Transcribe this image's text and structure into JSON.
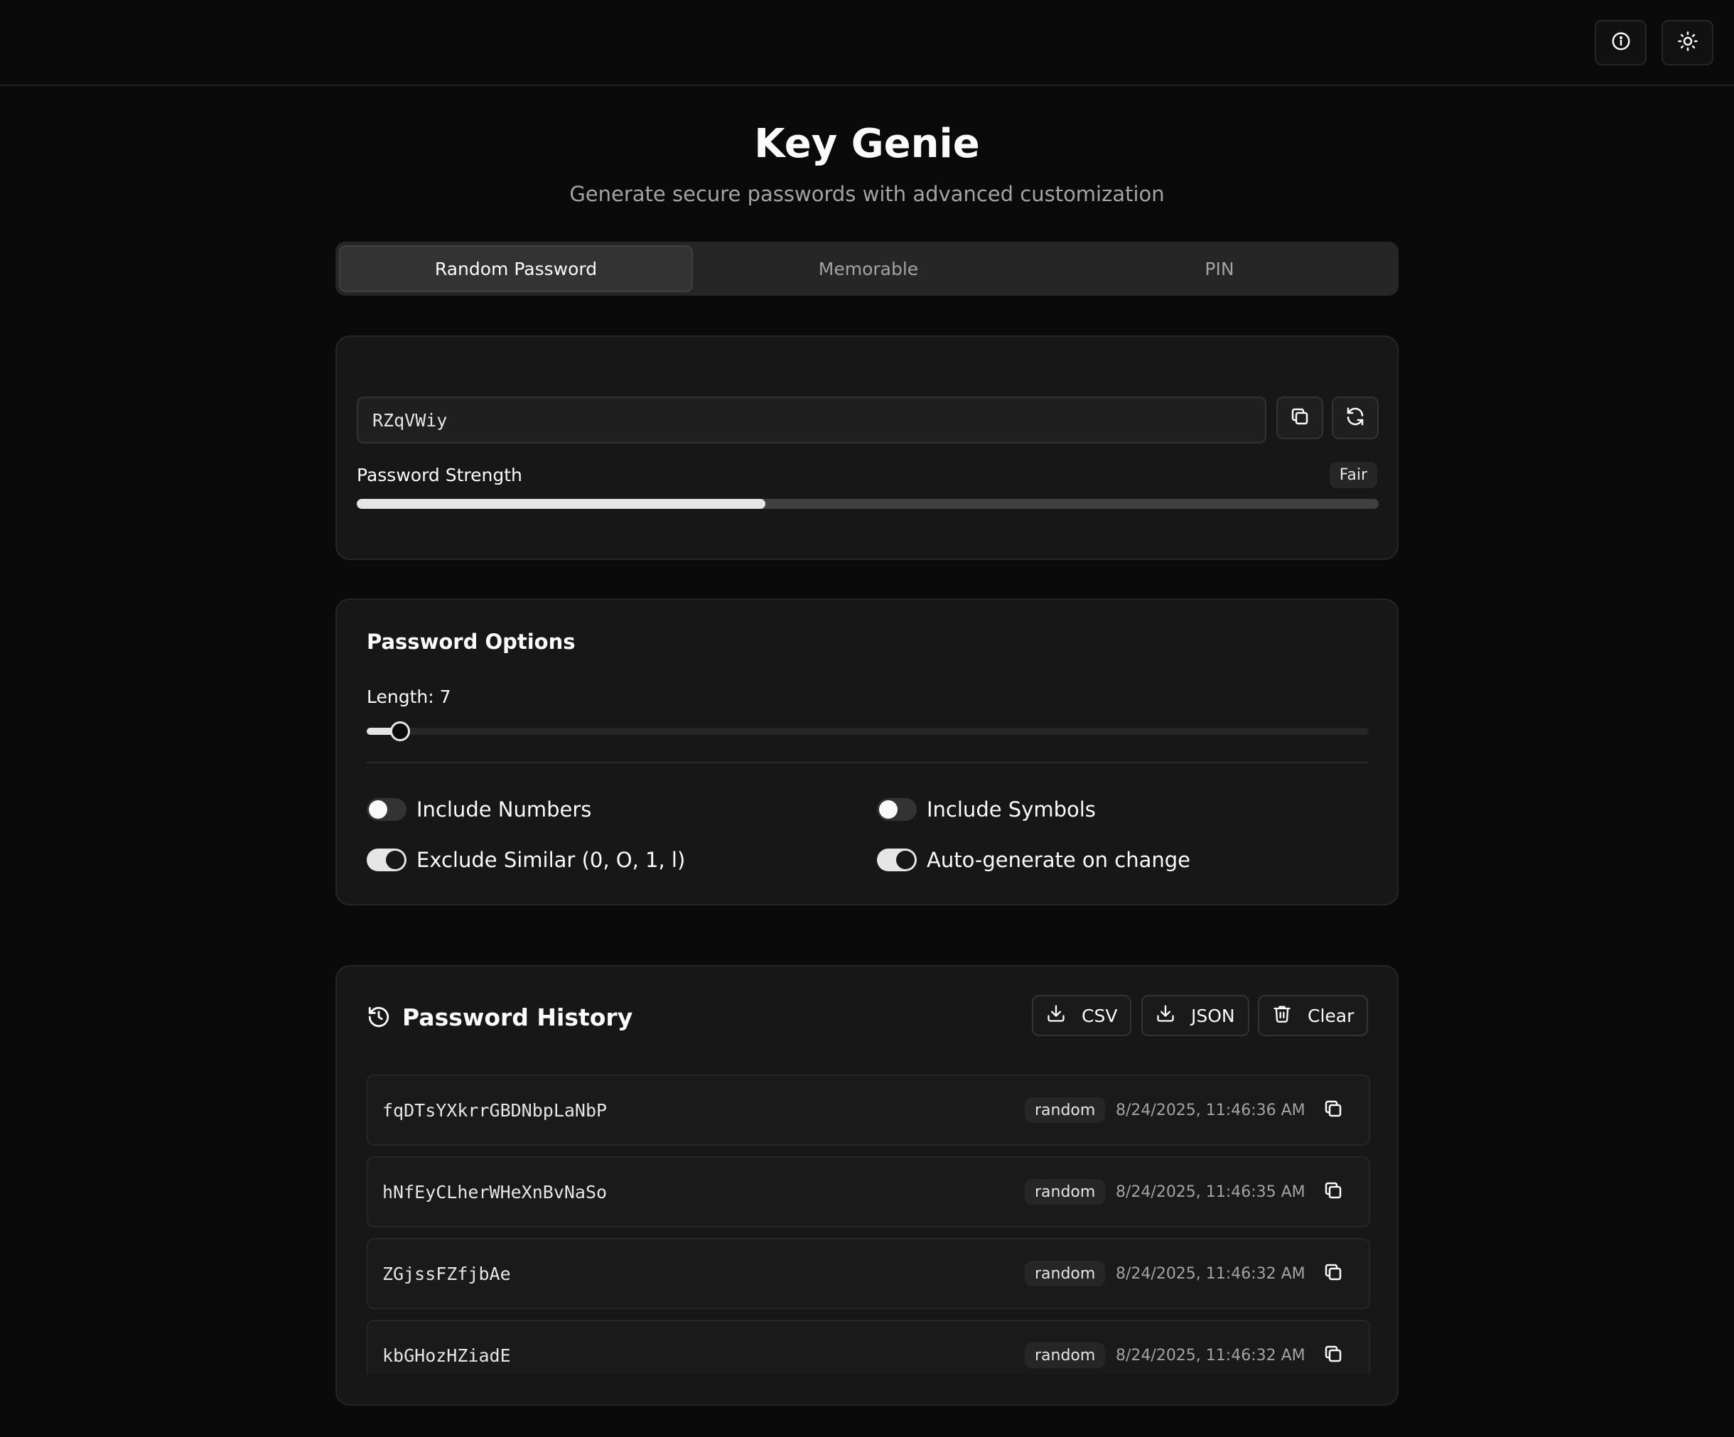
{
  "app": {
    "title": "Key Genie",
    "subtitle": "Generate secure passwords with advanced customization"
  },
  "header": {
    "info_icon": "info-icon",
    "theme_icon": "sun-icon"
  },
  "tabs": [
    {
      "label": "Random Password",
      "active": true
    },
    {
      "label": "Memorable",
      "active": false
    },
    {
      "label": "PIN",
      "active": false
    }
  ],
  "generator": {
    "password": "RZqVWiy",
    "strength_label": "Password Strength",
    "strength_value": "Fair",
    "strength_fraction": 0.4
  },
  "options": {
    "title": "Password Options",
    "length_label": "Length: 7",
    "length_fraction": 0.033,
    "toggles": [
      {
        "label": "Include Numbers",
        "on": false
      },
      {
        "label": "Include Symbols",
        "on": false
      },
      {
        "label": "Exclude Similar (0, O, 1, l)",
        "on": true
      },
      {
        "label": "Auto-generate on change",
        "on": true
      }
    ]
  },
  "history": {
    "title": "Password History",
    "csv_label": "CSV",
    "json_label": "JSON",
    "clear_label": "Clear",
    "items": [
      {
        "password": "fqDTsYXkrrGBDNbpLaNbP",
        "type": "random",
        "time": "8/24/2025, 11:46:36 AM"
      },
      {
        "password": "hNfEyCLherWHeXnBvNaSo",
        "type": "random",
        "time": "8/24/2025, 11:46:35 AM"
      },
      {
        "password": "ZGjssFZfjbAe",
        "type": "random",
        "time": "8/24/2025, 11:46:32 AM"
      },
      {
        "password": "kbGHozHZiadE",
        "type": "random",
        "time": "8/24/2025, 11:46:32 AM"
      }
    ]
  },
  "colors": {
    "background": "#0a0a0a",
    "card": "#171717",
    "accent": "#e5e5e5"
  }
}
